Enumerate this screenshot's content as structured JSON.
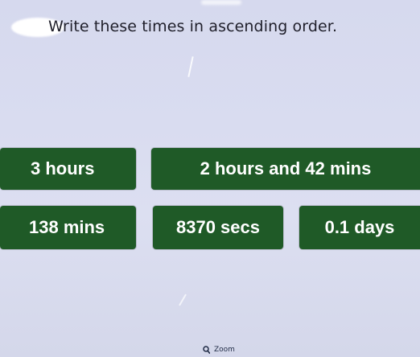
{
  "question": {
    "prompt": "Write these times in ascending order."
  },
  "tiles": [
    {
      "label": "3 hours"
    },
    {
      "label": "2 hours and 42 mins"
    },
    {
      "label": "138 mins"
    },
    {
      "label": "8370 secs"
    },
    {
      "label": "0.1 days"
    }
  ],
  "colors": {
    "tile_background": "#1f5a27",
    "tile_text": "#ffffff",
    "page_background": "#d9dcf0"
  },
  "toolbar": {
    "zoom_label": "Zoom",
    "zoom_icon": "magnifier-icon"
  }
}
